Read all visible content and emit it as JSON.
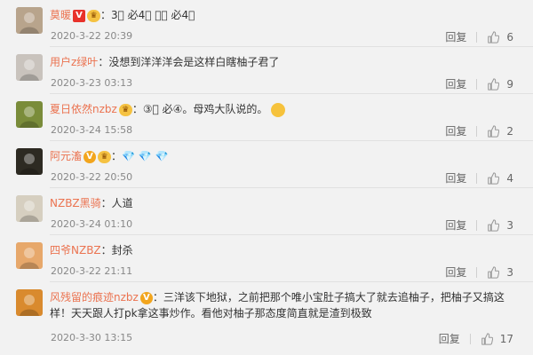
{
  "comments": [
    {
      "user": "莫暖",
      "content_before": "：3⃣️ 必4⃣️ 黑⃣️ 必4⃣️",
      "content_after": "",
      "badges": [
        "v-red",
        "level"
      ],
      "date": "2020-3-22 20:39",
      "reply": "回复",
      "likes": "6",
      "avatar_color": "#b8a48c"
    },
    {
      "user": "用户z绿叶",
      "content_before": "：没想到洋洋洋会是这样白瞎柚子君了",
      "content_after": "",
      "badges": [],
      "date": "2020-3-23 03:13",
      "reply": "回复",
      "likes": "9",
      "avatar_color": "#c9c3bd"
    },
    {
      "user": "夏日依然nzbz",
      "content_before": "：③⃣️ 必④。母鸡大队说的。",
      "content_after": "",
      "badges": [
        "level"
      ],
      "emoji": "smirk-emoji",
      "date": "2020-3-24 15:58",
      "reply": "回复",
      "likes": "2",
      "avatar_color": "#7a8c3a"
    },
    {
      "user": "阿元滀",
      "content_before": "：💎 💎 💎",
      "content_after": "",
      "badges": [
        "v-yellow",
        "level"
      ],
      "date": "2020-3-22 20:50",
      "reply": "回复",
      "likes": "4",
      "avatar_color": "#2d2a22"
    },
    {
      "user": "NZBZ黑骑",
      "content_before": "：人道",
      "content_after": "",
      "badges": [],
      "date": "2020-3-24 01:10",
      "reply": "回复",
      "likes": "3",
      "avatar_color": "#d6cfc0"
    },
    {
      "user": "四爷NZBZ",
      "content_before": "：封杀",
      "content_after": "",
      "badges": [],
      "date": "2020-3-22 21:11",
      "reply": "回复",
      "likes": "3",
      "avatar_color": "#e7a86b"
    },
    {
      "user": "风残留的痕迹nzbz",
      "content_before": "：三洋该下地狱，之前把那个唯小宝肚子搞大了就去追柚子，把柚子又搞这样！天天跟人打pk拿这事炒作。看他对柚子那态度简直就是渣到极致",
      "content_after": "",
      "badges": [
        "v-yellow"
      ],
      "date": "2020-3-30 13:15",
      "reply": "回复",
      "likes": "17",
      "avatar_color": "#d98a2e"
    }
  ],
  "colors": {
    "username": "#eb7350",
    "date": "#888888",
    "background": "#f2f2f2"
  },
  "icons": {
    "like": "thumbs-up-icon"
  }
}
